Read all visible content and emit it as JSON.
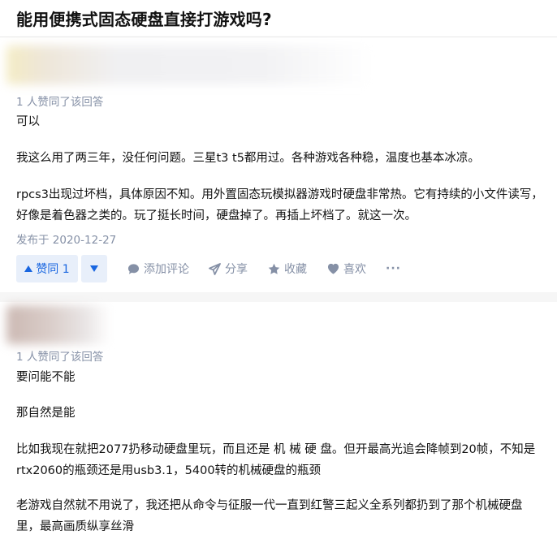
{
  "question": {
    "title": "能用便携式固态硬盘直接打游戏吗?"
  },
  "answers": [
    {
      "vote_info": "1 人赞同了该回答",
      "paragraphs": [
        "可以",
        "我这么用了两三年，没任何问题。三星t3 t5都用过。各种游戏各种稳，温度也基本冰凉。",
        "rpcs3出现过坏档，具体原因不知。用外置固态玩模拟器游戏时硬盘非常热。它有持续的小文件读写，好像是着色器之类的。玩了挺长时间，硬盘掉了。再插上坏档了。就这一次。"
      ],
      "published": "发布于 2020-12-27",
      "actions": {
        "upvote": "赞同 1",
        "comment": "添加评论",
        "share": "分享",
        "collect": "收藏",
        "like": "喜欢",
        "more": "···"
      }
    },
    {
      "vote_info": "1 人赞同了该回答",
      "paragraphs": [
        "要问能不能",
        "那自然是能",
        "比如我现在就把2077扔移动硬盘里玩，而且还是 机 械 硬 盘。但开最高光追会降帧到20帧，不知是rtx2060的瓶颈还是用usb3.1，5400转的机械硬盘的瓶颈",
        "老游戏自然就不用说了，我还把从命令与征服一代一直到红警三起义全系列都扔到了那个机械硬盘里，最高画质纵享丝滑"
      ]
    }
  ],
  "colors": {
    "accent": "#1966e0",
    "muted": "#8590a6",
    "vote_bg": "#e8effa"
  },
  "icons": [
    "caret-up-icon",
    "caret-down-icon",
    "comment-icon",
    "share-icon",
    "star-icon",
    "heart-icon",
    "more-icon"
  ]
}
